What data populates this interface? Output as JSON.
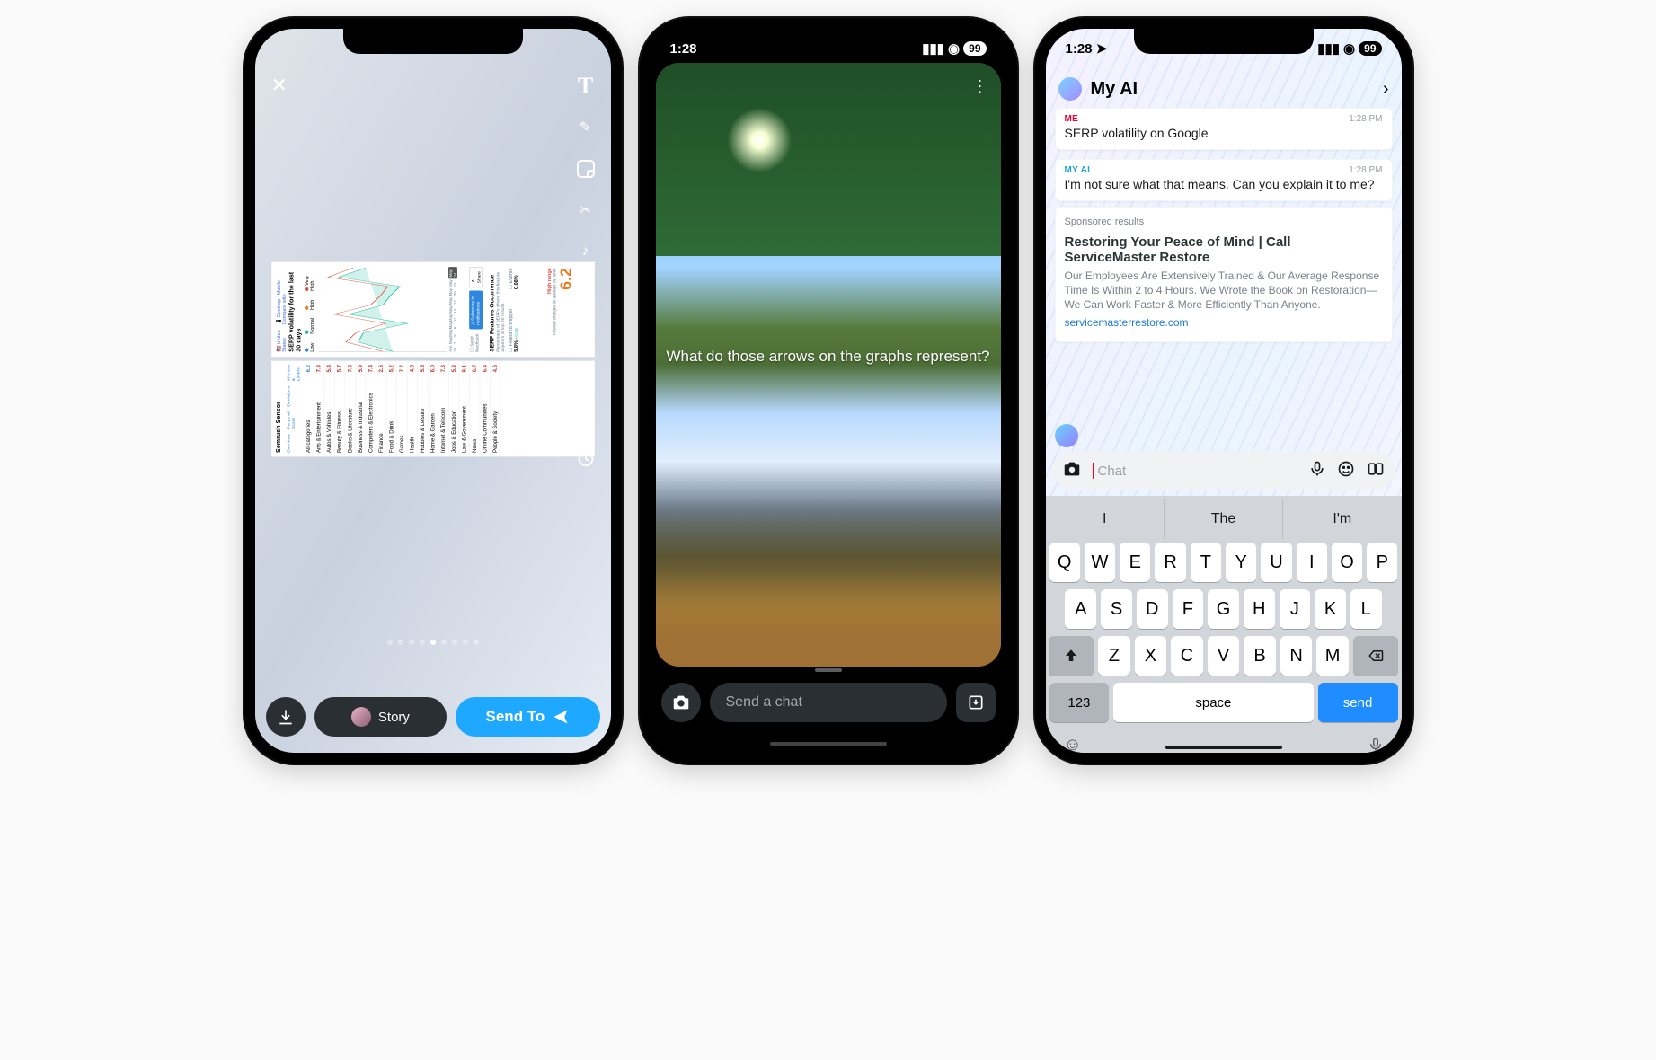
{
  "status": {
    "time": "1:28",
    "battery": "99"
  },
  "phone1": {
    "sensor_title": "Semrush Sensor",
    "tabs": [
      "Overview",
      "Personal Score",
      "Deviations",
      "Winners & Losers"
    ],
    "cat_header_left": "All categories",
    "categories": [
      {
        "label": "All categories",
        "val": "6.2"
      },
      {
        "label": "Arts & Entertainment",
        "val": "7.3"
      },
      {
        "label": "Autos & Vehicles",
        "val": "5.4"
      },
      {
        "label": "Beauty & Fitness",
        "val": "5.7"
      },
      {
        "label": "Books & Literature",
        "val": "7.3"
      },
      {
        "label": "Business & Industrial",
        "val": "5.9"
      },
      {
        "label": "Computers & Electronics",
        "val": "7.4"
      },
      {
        "label": "Finance",
        "val": "2.6"
      },
      {
        "label": "Food & Drink",
        "val": "5.2"
      },
      {
        "label": "Games",
        "val": "7.2"
      },
      {
        "label": "Health",
        "val": "4.8"
      },
      {
        "label": "Hobbies & Leisure",
        "val": "5.5"
      },
      {
        "label": "Home & Garden",
        "val": "6.0"
      },
      {
        "label": "Internet & Telecom",
        "val": "7.3"
      },
      {
        "label": "Jobs & Education",
        "val": "5.3"
      },
      {
        "label": "Law & Government",
        "val": "9.1"
      },
      {
        "label": "News",
        "val": "6.7"
      },
      {
        "label": "Online Communities",
        "val": "6.4"
      },
      {
        "label": "People & Society",
        "val": "4.6"
      }
    ],
    "chart_title": "SERP volatility for the last 30 days",
    "region": "United States",
    "device_desktop": "Desktop",
    "device_mobile": "Mobile",
    "compare": "Compare with",
    "chart_legend": {
      "low": "Low",
      "normal": "Normal",
      "high": "High",
      "vhigh": "Very High"
    },
    "score_label": "High range",
    "score_sub": "Position changes on average vs. other",
    "score_value": "6.2",
    "cta1": "Send feedback",
    "cta2": "Subscribe to notifications",
    "cta3": "Share",
    "features_title": "SERP Features Occurrence",
    "features_sub": "Percentage of SERPs where this feature appears in top 20 results",
    "feat1": "Featured snippet",
    "feat1_val": "5.8%",
    "feat1_delta": "+0.06",
    "feat2": "Events",
    "feat2_val": "0.08%",
    "tools": [
      "text",
      "draw",
      "sticker",
      "scissors",
      "music",
      "magic",
      "attach",
      "crop",
      "timer"
    ],
    "story_label": "Story",
    "send_label": "Send To"
  },
  "phone2": {
    "caption": "What do those arrows on the graphs represent?",
    "chat_placeholder": "Send a chat"
  },
  "phone3": {
    "title": "My AI",
    "me_label": "ME",
    "ai_label": "MY AI",
    "msg_time": "1:28 PM",
    "me_msg": "SERP volatility on Google",
    "ai_msg": "I'm not sure what that means. Can you explain it to me?",
    "sponsored_label": "Sponsored results",
    "sp_title": "Restoring Your Peace of Mind | Call ServiceMaster Restore",
    "sp_body": "Our Employees Are Extensively Trained & Our Average Response Time Is Within 2 to 4 Hours. We Wrote the Book on Restoration—We Can Work Faster & More Efficiently Than Anyone.",
    "sp_link": "servicemasterrestore.com",
    "chat_placeholder": "Chat",
    "suggestions": [
      "I",
      "The",
      "I'm"
    ],
    "keys_row1": [
      "Q",
      "W",
      "E",
      "R",
      "T",
      "Y",
      "U",
      "I",
      "O",
      "P"
    ],
    "keys_row2": [
      "A",
      "S",
      "D",
      "F",
      "G",
      "H",
      "J",
      "K",
      "L"
    ],
    "keys_row3": [
      "Z",
      "X",
      "C",
      "V",
      "B",
      "N",
      "M"
    ],
    "key_123": "123",
    "key_space": "space",
    "key_send": "send"
  },
  "chart_data": {
    "type": "line",
    "title": "SERP volatility for the last 30 days",
    "xlabel": "",
    "ylabel": "",
    "x": [
      "Apr 29",
      "May 2",
      "May 5",
      "May 8",
      "May 11",
      "May 14",
      "May 17",
      "May 20",
      "May 23",
      "May 24"
    ],
    "ylim": [
      0,
      10
    ],
    "series": [
      {
        "name": "All categories",
        "values": [
          4.2,
          6.1,
          5.8,
          3.2,
          7.4,
          4.6,
          4.1,
          3.5,
          8.2,
          6.2
        ],
        "color": "#1abc9c"
      },
      {
        "name": "Law & Government",
        "values": [
          5.0,
          7.2,
          6.4,
          4.8,
          8.5,
          5.9,
          5.2,
          4.7,
          9.1,
          7.0
        ],
        "color": "#e74c3c"
      }
    ]
  }
}
